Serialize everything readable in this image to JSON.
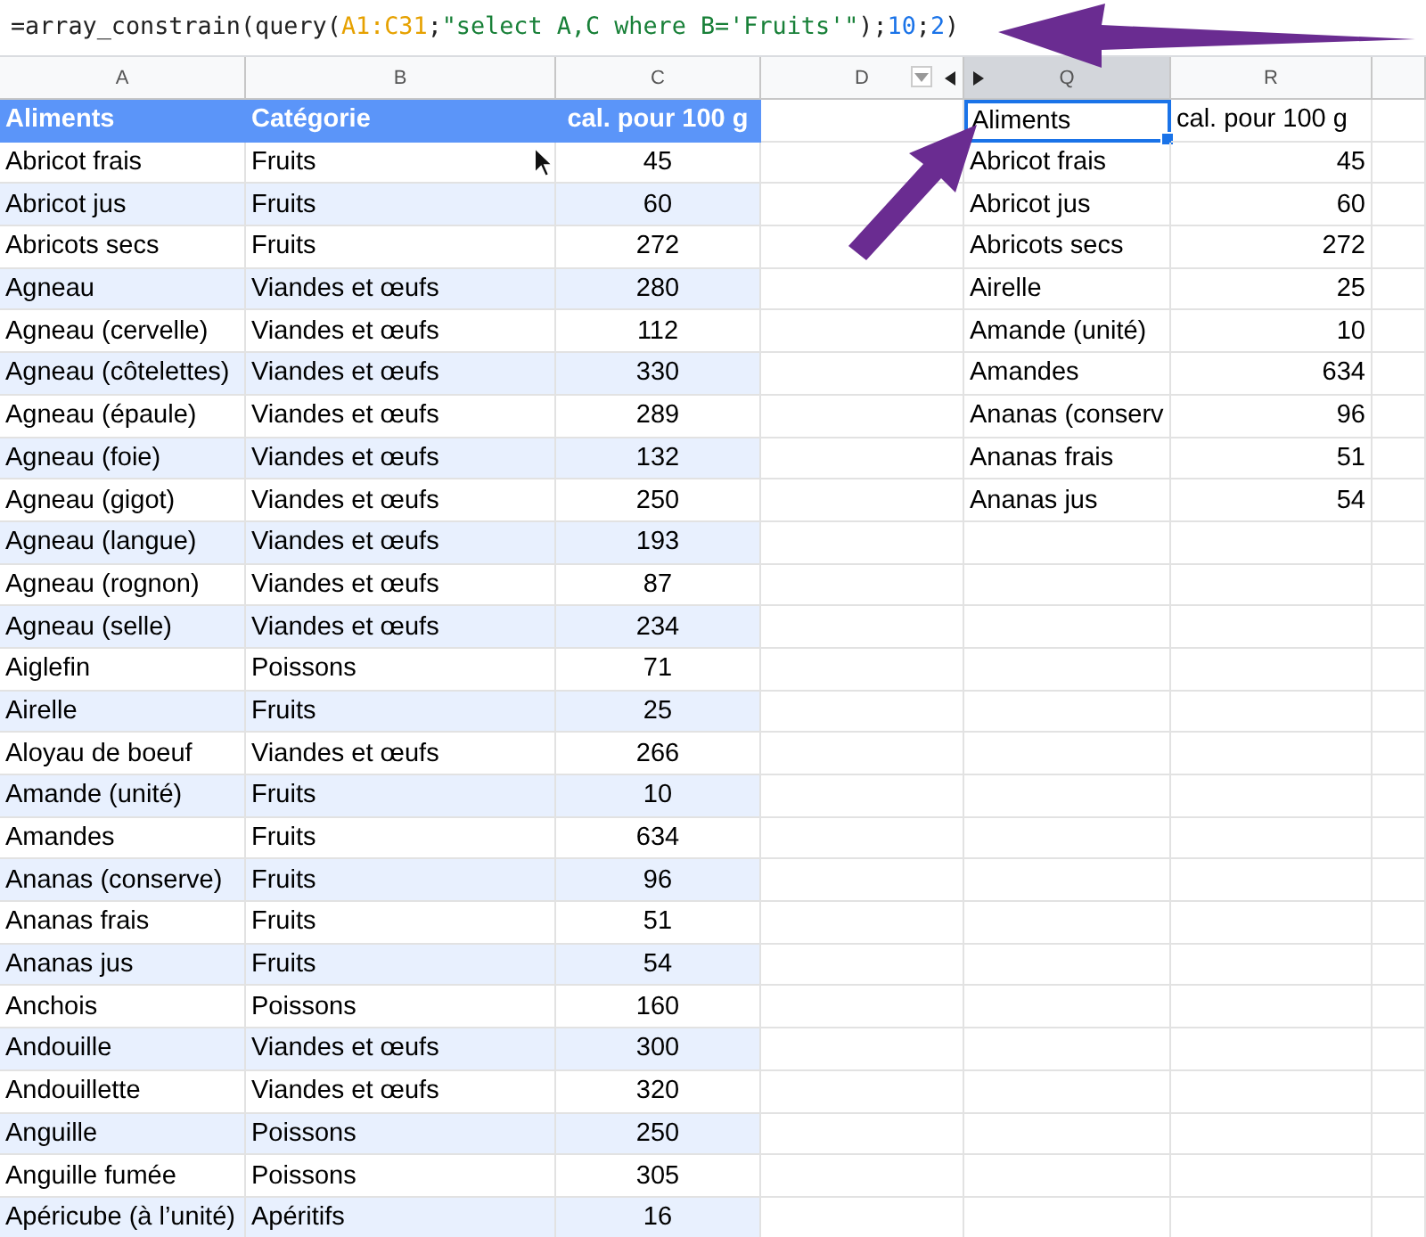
{
  "formula_bar": {
    "segments": [
      {
        "text": "=array_constrain(query(",
        "color": "#222222"
      },
      {
        "text": "A1:C31",
        "color": "#e6a100"
      },
      {
        "text": ";",
        "color": "#222222"
      },
      {
        "text": "\"select A,C where B='Fruits'\"",
        "color": "#188038"
      },
      {
        "text": ");",
        "color": "#222222"
      },
      {
        "text": "10",
        "color": "#1a73e8"
      },
      {
        "text": ";",
        "color": "#222222"
      },
      {
        "text": "2",
        "color": "#1a73e8"
      },
      {
        "text": ")",
        "color": "#222222"
      }
    ]
  },
  "columns": [
    {
      "label": "A",
      "selected": false
    },
    {
      "label": "B",
      "selected": false
    },
    {
      "label": "C",
      "selected": false
    },
    {
      "label": "D",
      "selected": false,
      "filter": true,
      "collapse": true
    },
    {
      "label": "Q",
      "selected": true,
      "expand": true
    },
    {
      "label": "R",
      "selected": false
    }
  ],
  "source_table": {
    "header": [
      "Aliments",
      "Catégorie",
      "cal. pour 100 g"
    ],
    "rows": [
      [
        "Abricot frais",
        "Fruits",
        "45"
      ],
      [
        "Abricot jus",
        "Fruits",
        "60"
      ],
      [
        "Abricots secs",
        "Fruits",
        "272"
      ],
      [
        "Agneau",
        "Viandes et œufs",
        "280"
      ],
      [
        "Agneau (cervelle)",
        "Viandes et œufs",
        "112"
      ],
      [
        "Agneau (côtelettes)",
        "Viandes et œufs",
        "330"
      ],
      [
        "Agneau (épaule)",
        "Viandes et œufs",
        "289"
      ],
      [
        "Agneau (foie)",
        "Viandes et œufs",
        "132"
      ],
      [
        "Agneau (gigot)",
        "Viandes et œufs",
        "250"
      ],
      [
        "Agneau (langue)",
        "Viandes et œufs",
        "193"
      ],
      [
        "Agneau (rognon)",
        "Viandes et œufs",
        "87"
      ],
      [
        "Agneau (selle)",
        "Viandes et œufs",
        "234"
      ],
      [
        "Aiglefin",
        "Poissons",
        "71"
      ],
      [
        "Airelle",
        "Fruits",
        "25"
      ],
      [
        "Aloyau de boeuf",
        "Viandes et œufs",
        "266"
      ],
      [
        "Amande (unité)",
        "Fruits",
        "10"
      ],
      [
        "Amandes",
        "Fruits",
        "634"
      ],
      [
        "Ananas (conserve)",
        "Fruits",
        "96"
      ],
      [
        "Ananas frais",
        "Fruits",
        "51"
      ],
      [
        "Ananas jus",
        "Fruits",
        "54"
      ],
      [
        "Anchois",
        "Poissons",
        "160"
      ],
      [
        "Andouille",
        "Viandes et œufs",
        "300"
      ],
      [
        "Andouillette",
        "Viandes et œufs",
        "320"
      ],
      [
        "Anguille",
        "Poissons",
        "250"
      ],
      [
        "Anguille fumée",
        "Poissons",
        "305"
      ],
      [
        "Apéricube (à l’unité)",
        "Apéritifs",
        "16"
      ]
    ]
  },
  "result_table": {
    "rows": [
      {
        "cells": [
          "Aliments",
          "cal. pour 100 g"
        ],
        "selected": true
      },
      {
        "cells": [
          "Abricot frais",
          "45"
        ],
        "selected": false
      },
      {
        "cells": [
          "Abricot jus",
          "60"
        ],
        "selected": false
      },
      {
        "cells": [
          "Abricots secs",
          "272"
        ],
        "selected": false
      },
      {
        "cells": [
          "Airelle",
          "25"
        ],
        "selected": false
      },
      {
        "cells": [
          "Amande (unité)",
          "10"
        ],
        "selected": false
      },
      {
        "cells": [
          "Amandes",
          "634"
        ],
        "selected": false
      },
      {
        "cells": [
          "Ananas (conserv",
          "96"
        ],
        "selected": false
      },
      {
        "cells": [
          "Ananas frais",
          "51"
        ],
        "selected": false
      },
      {
        "cells": [
          "Ananas jus",
          "54"
        ],
        "selected": false
      }
    ]
  }
}
